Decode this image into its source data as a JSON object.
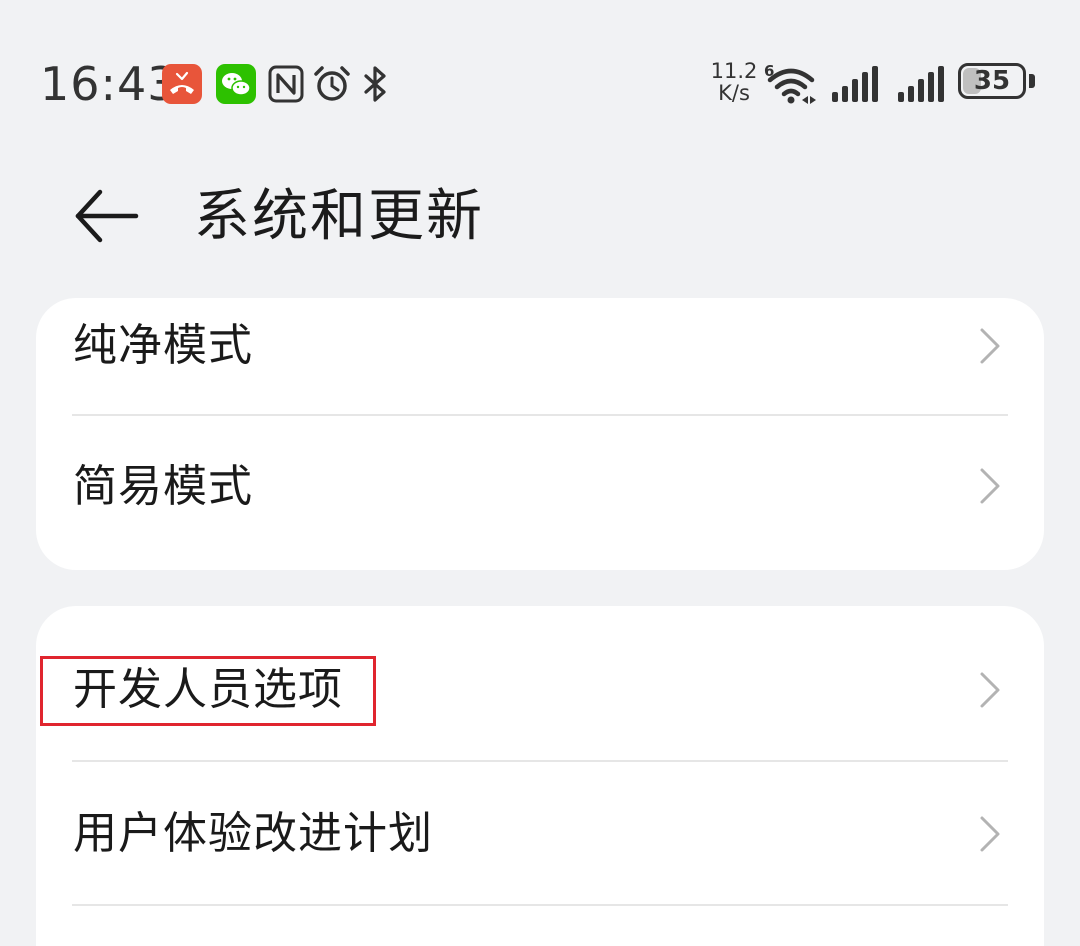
{
  "status_bar": {
    "time": "16:43",
    "icons": [
      "call-missed-icon",
      "wechat-icon",
      "nfc-icon",
      "alarm-icon",
      "bluetooth-icon",
      "wifi-icon",
      "signal-icon",
      "signal-icon",
      "battery-icon"
    ],
    "net_speed_value": "11.2",
    "net_speed_unit": "K/s",
    "wifi_badge": "6",
    "battery_level": "35",
    "battery_fraction": 0.35,
    "colors": {
      "call_missed": "#e8553a",
      "wechat": "#2dc100"
    }
  },
  "header": {
    "title": "系统和更新",
    "back_icon": "arrow-left-icon"
  },
  "group_1": {
    "items": [
      {
        "label": "纯净模式",
        "icon": "chevron-right-icon"
      },
      {
        "label": "简易模式",
        "icon": "chevron-right-icon"
      }
    ]
  },
  "group_2": {
    "items": [
      {
        "label": "开发人员选项",
        "icon": "chevron-right-icon",
        "highlighted": true
      },
      {
        "label": "用户体验改进计划",
        "icon": "chevron-right-icon"
      }
    ],
    "highlight_color": "#e0252e"
  }
}
